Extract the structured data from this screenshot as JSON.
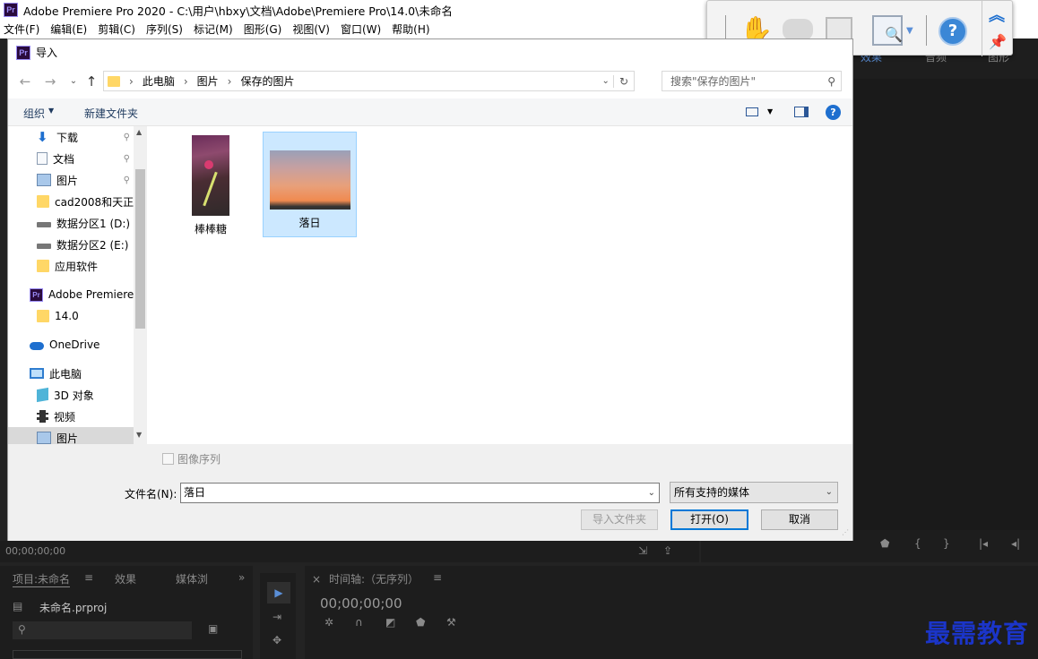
{
  "app": {
    "title": "Adobe Premiere Pro 2020 - C:\\用户\\hbxy\\文档\\Adobe\\Premiere Pro\\14.0\\未命名",
    "logo": "Pr",
    "menu": [
      "文件(F)",
      "编辑(E)",
      "剪辑(C)",
      "序列(S)",
      "标记(M)",
      "图形(G)",
      "视图(V)",
      "窗口(W)",
      "帮助(H)"
    ]
  },
  "background": {
    "right_tabs": [
      "效果",
      "音频",
      "图形"
    ],
    "timecode_left": "00;00;00;00",
    "project_tabs": [
      "项目:未命名",
      "效果",
      "媒体浏"
    ],
    "project_file": "未命名.prproj",
    "timeline_title": "时间轴:（无序列）",
    "timeline_timecode": "00;00;00;00",
    "watermark": "最需教育"
  },
  "dialog": {
    "title": "导入",
    "breadcrumb": [
      "此电脑",
      "图片",
      "保存的图片"
    ],
    "search_placeholder": "搜索\"保存的图片\"",
    "organize": "组织",
    "new_folder": "新建文件夹",
    "nav_items": [
      {
        "label": "下载",
        "icon": "download-icon",
        "pinned": true
      },
      {
        "label": "文档",
        "icon": "document-icon",
        "pinned": true
      },
      {
        "label": "图片",
        "icon": "pictures-icon",
        "pinned": true
      },
      {
        "label": "cad2008和天正",
        "icon": "folder-icon",
        "pinned": false
      },
      {
        "label": "数据分区1 (D:)",
        "icon": "drive-icon",
        "pinned": false
      },
      {
        "label": "数据分区2 (E:)",
        "icon": "drive-icon",
        "pinned": false
      },
      {
        "label": "应用软件",
        "icon": "folder-icon",
        "pinned": false
      },
      {
        "label": "Adobe Premiere",
        "icon": "premiere-icon",
        "pinned": false
      },
      {
        "label": "14.0",
        "icon": "folder-icon",
        "pinned": false
      },
      {
        "label": "OneDrive",
        "icon": "cloud-icon",
        "pinned": false
      },
      {
        "label": "此电脑",
        "icon": "computer-icon",
        "pinned": false
      },
      {
        "label": "3D 对象",
        "icon": "cube-icon",
        "pinned": false
      },
      {
        "label": "视频",
        "icon": "video-icon",
        "pinned": false
      },
      {
        "label": "图片",
        "icon": "pictures-icon",
        "pinned": false
      }
    ],
    "files": [
      {
        "name": "棒棒糖",
        "selected": false
      },
      {
        "name": "落日",
        "selected": true
      }
    ],
    "image_sequence": "图像序列",
    "filename_label": "文件名(N):",
    "filename_value": "落日",
    "filetype": "所有支持的媒体",
    "import_folder_btn": "导入文件夹",
    "open_btn": "打开(O)",
    "cancel_btn": "取消"
  },
  "colors": {
    "accent": "#0078d7",
    "selection": "#cce8ff",
    "premiere_bg": "#232323"
  }
}
